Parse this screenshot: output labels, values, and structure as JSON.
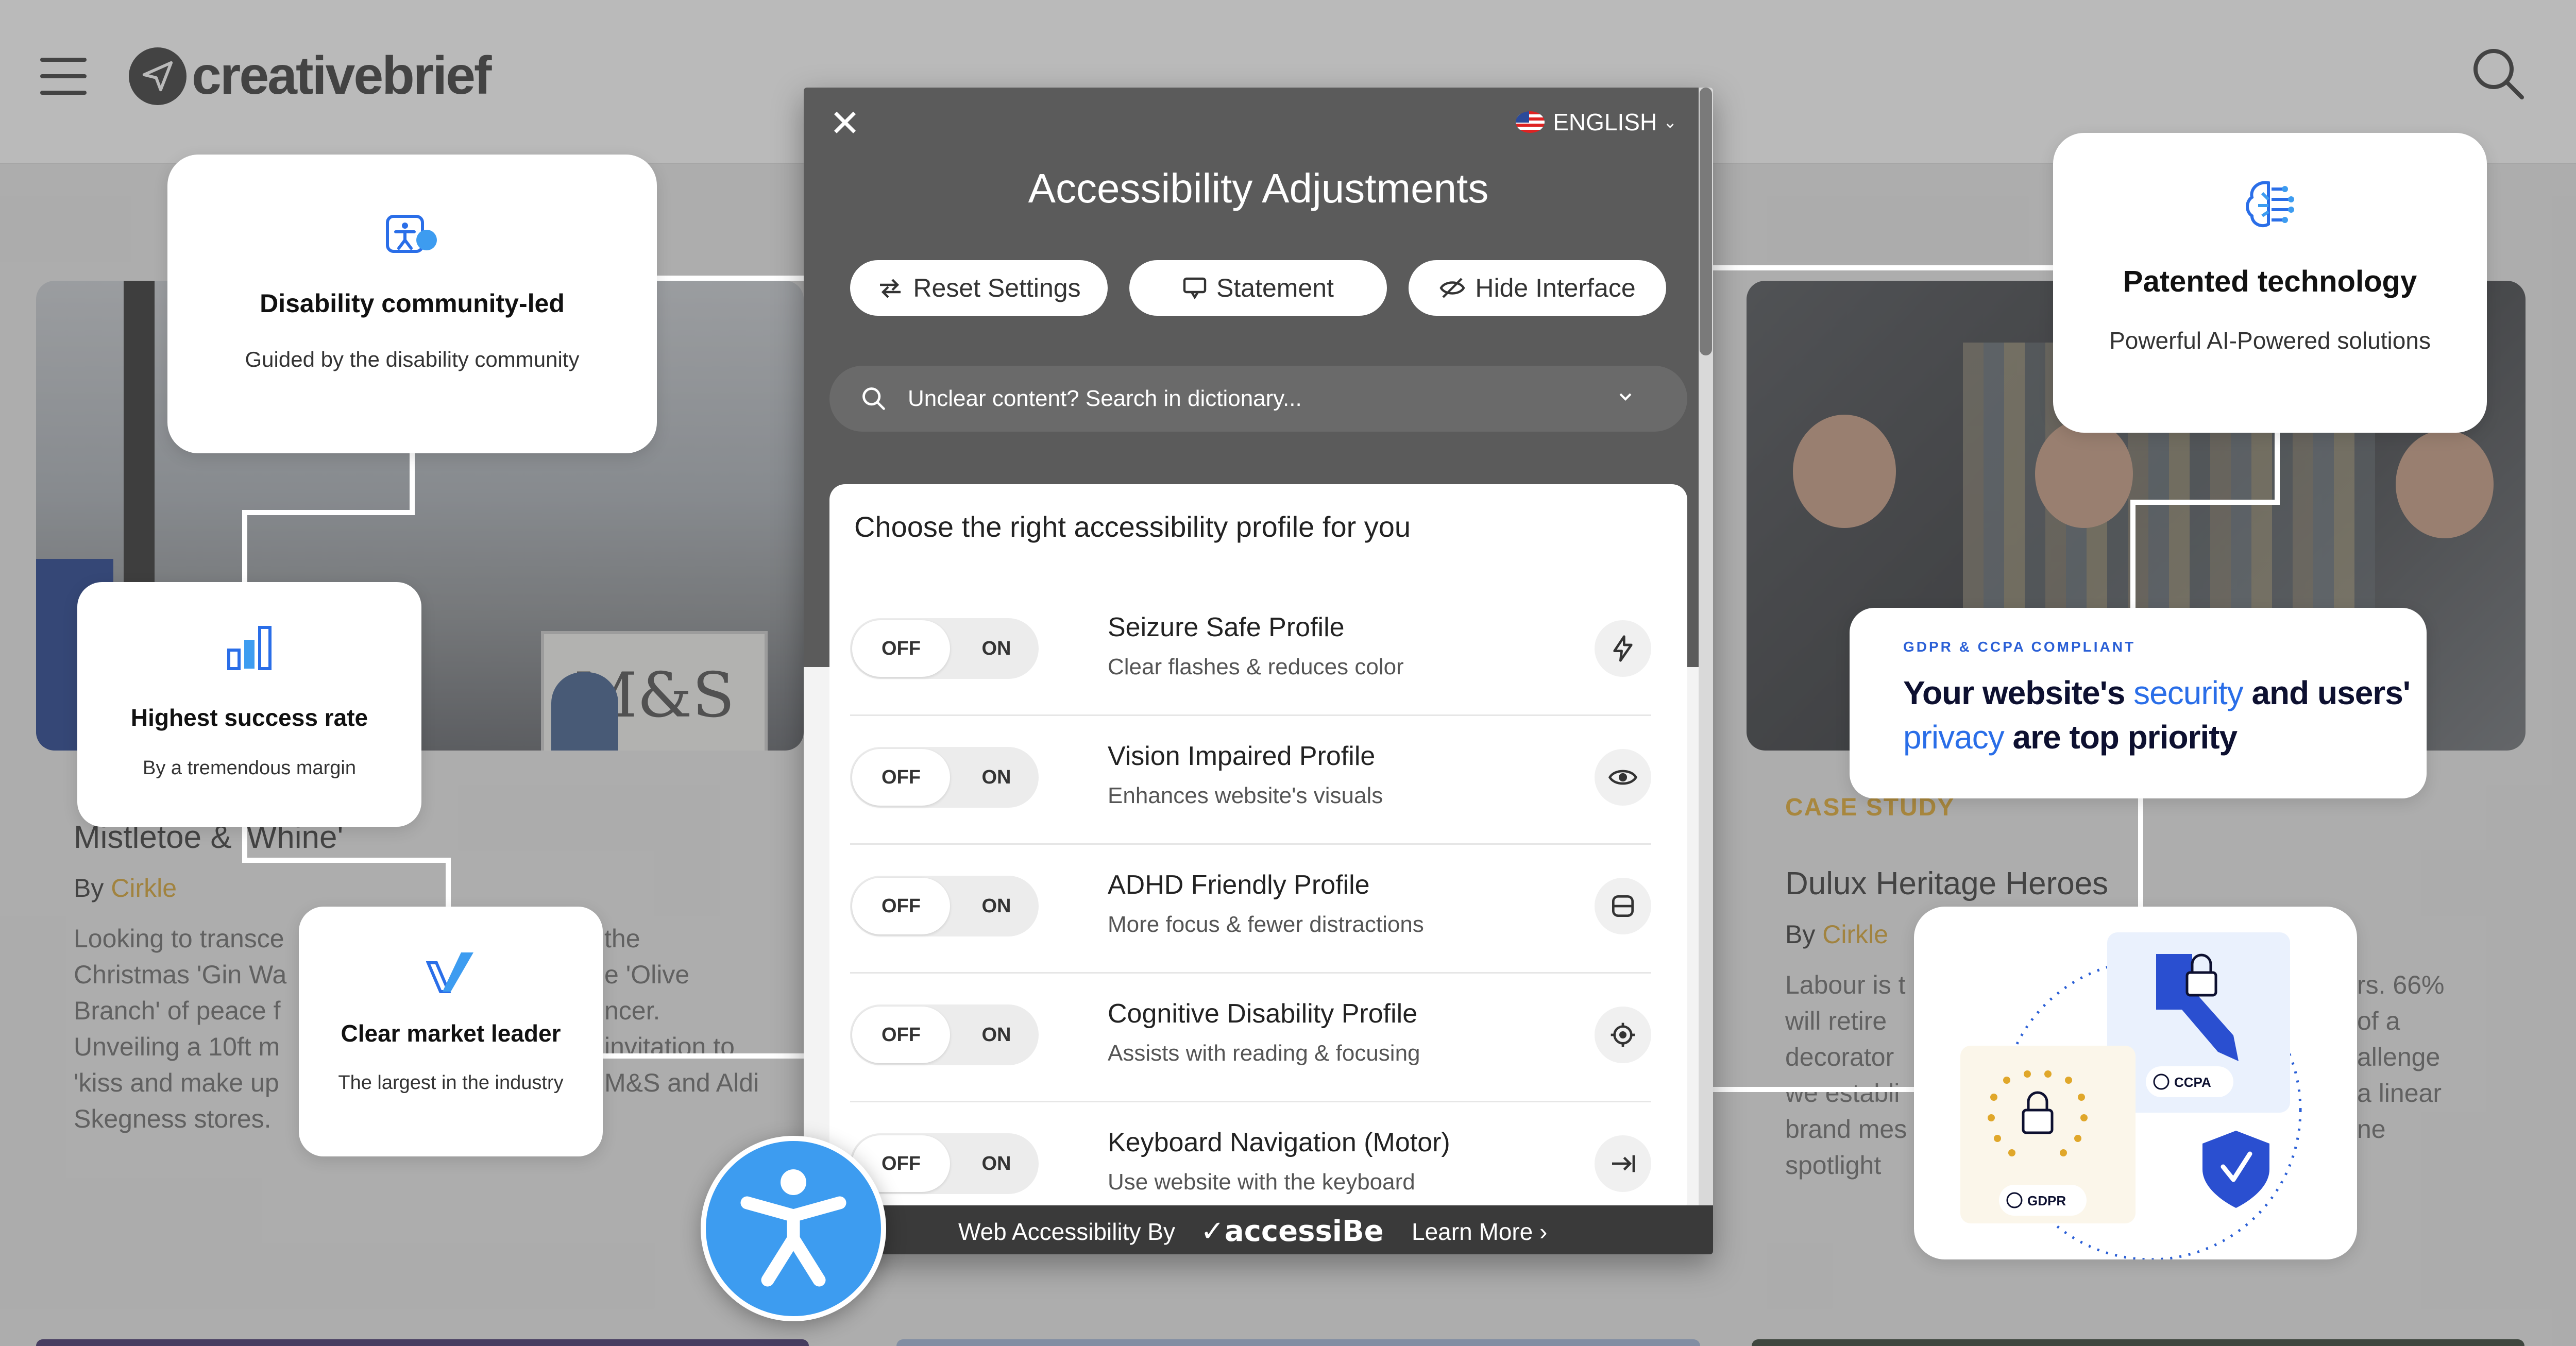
{
  "site": {
    "brand": "creativebrief",
    "left_article": {
      "title": "Mistletoe & 'Whine'",
      "by_prefix": "By",
      "author": "Cirkle",
      "body_lines": [
        "Looking to transce",
        "Christmas 'Gin Wa",
        "Branch' of peace f",
        "Unveiling a 10ft m",
        "'kiss and make up",
        "Skegness stores."
      ],
      "body_right_lines": [
        "the",
        "e 'Olive",
        "ncer.",
        "invitation to",
        "M&S and Aldi",
        ""
      ]
    },
    "right_article": {
      "label": "CASE STUDY",
      "title": "Dulux Heritage Heroes",
      "by_prefix": "By",
      "author": "Cirkle",
      "body_lines": [
        "Labour is t",
        "will retire",
        "decorator",
        "we establi",
        "brand mes",
        "spotlight"
      ],
      "body_right_lines": [
        "rs. 66%",
        "of a",
        "allenge",
        "a linear",
        "ne",
        ""
      ]
    },
    "photo_sign_text": "M&S"
  },
  "cards": {
    "community": {
      "title": "Disability community-led",
      "subtitle": "Guided by the disability community"
    },
    "success": {
      "title": "Highest success rate",
      "subtitle": "By a tremendous margin"
    },
    "leader": {
      "title": "Clear market leader",
      "subtitle": "The largest in the industry"
    },
    "patented": {
      "title": "Patented technology",
      "subtitle": "Powerful AI-Powered solutions"
    },
    "gdpr": {
      "kicker": "GDPR & CCPA COMPLIANT",
      "line1_a": "Your website's ",
      "line1_b": "security",
      "line1_c": " and users'",
      "line2_a": "privacy",
      "line2_b": " are top priority"
    },
    "compliance": {
      "ccpa_label": "CCPA",
      "gdpr_label": "GDPR"
    }
  },
  "panel": {
    "language": "ENGLISH",
    "title": "Accessibility Adjustments",
    "buttons": {
      "reset": "Reset Settings",
      "statement": "Statement",
      "hide": "Hide Interface"
    },
    "dictionary_placeholder": "Unclear content? Search in dictionary...",
    "profiles_heading": "Choose the right accessibility profile for you",
    "toggle_off": "OFF",
    "toggle_on": "ON",
    "profiles": [
      {
        "name": "Seizure Safe Profile",
        "desc": "Clear flashes & reduces color",
        "icon": "lightning-icon"
      },
      {
        "name": "Vision Impaired Profile",
        "desc": "Enhances website's visuals",
        "icon": "eye-icon"
      },
      {
        "name": "ADHD Friendly Profile",
        "desc": "More focus & fewer distractions",
        "icon": "focus-frame-icon"
      },
      {
        "name": "Cognitive Disability Profile",
        "desc": "Assists with reading & focusing",
        "icon": "target-icon"
      },
      {
        "name": "Keyboard Navigation (Motor)",
        "desc": "Use website with the keyboard",
        "icon": "tab-arrow-icon"
      }
    ],
    "footer": {
      "by": "Web Accessibility By",
      "brand": "accessiBe",
      "learn": "Learn More"
    }
  },
  "colors": {
    "accent_blue": "#3d9cf0",
    "panel_dark": "#5b5b5b",
    "gold": "#d4a02c",
    "brand_blue": "#2a6ee8"
  }
}
